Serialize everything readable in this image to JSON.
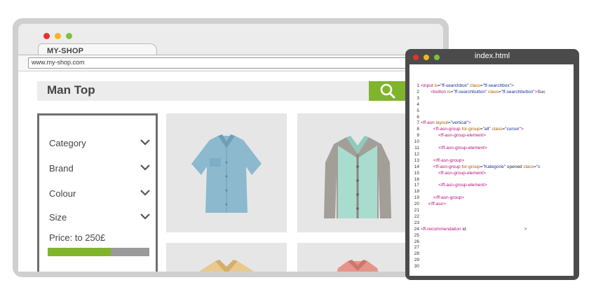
{
  "browser": {
    "tab_title": "MY-SHOP",
    "address": "www.my-shop.com"
  },
  "shop": {
    "search_title": "Man Top",
    "search_icon": "magnifier-icon",
    "filters": [
      {
        "label": "Category",
        "icon": "chevron-down-icon"
      },
      {
        "label": "Brand",
        "icon": "chevron-down-icon"
      },
      {
        "label": "Colour",
        "icon": "chevron-down-icon"
      },
      {
        "label": "Size",
        "icon": "chevron-down-icon"
      }
    ],
    "price_label": "Price:  to 250£",
    "price_fill_fraction": 0.62,
    "products": [
      {
        "name": "blue-short-sleeve-shirt"
      },
      {
        "name": "cardigan"
      },
      {
        "name": "yellow-shirt"
      },
      {
        "name": "red-shirt"
      }
    ]
  },
  "editor": {
    "title": "index.html",
    "lines": [
      {
        "n": "1",
        "code": "<input is=\"ff-searchbox\" class=\"ff-searchbox\">"
      },
      {
        "n": "2",
        "code": "        <button is=\"ff-searchbutton\" class=\"ff-searchbutton\">Suc"
      },
      {
        "n": "3",
        "code": ""
      },
      {
        "n": "4",
        "code": ""
      },
      {
        "n": "5",
        "code": ""
      },
      {
        "n": "6",
        "code": ""
      },
      {
        "n": "7",
        "code": "<ff-asn layout=\"vertical\">"
      },
      {
        "n": "8",
        "code": "          <ff-asn-group for-group=\"all\" class=\"cursor\">"
      },
      {
        "n": "9",
        "code": "              <ff-asn-group-element>"
      },
      {
        "n": "10",
        "code": ""
      },
      {
        "n": "11",
        "code": "              </ff-asn-group-element>"
      },
      {
        "n": "12",
        "code": ""
      },
      {
        "n": "13",
        "code": "          </ff-asn-group>"
      },
      {
        "n": "14",
        "code": "          <ff-asn-group for-group=\"Kategorie\" opened class=\"c"
      },
      {
        "n": "15",
        "code": "              <ff-asn-group-element>"
      },
      {
        "n": "16",
        "code": ""
      },
      {
        "n": "17",
        "code": "              </ff-asn-group-element>"
      },
      {
        "n": "18",
        "code": ""
      },
      {
        "n": "19",
        "code": "          </ff-asn-group>"
      },
      {
        "n": "20",
        "code": "      </ff-asn>"
      },
      {
        "n": "21",
        "code": ""
      },
      {
        "n": "22",
        "code": ""
      },
      {
        "n": "23",
        "code": ""
      },
      {
        "n": "24",
        "code": "<ff-recommendation id                                              >"
      },
      {
        "n": "25",
        "code": ""
      },
      {
        "n": "26",
        "code": ""
      },
      {
        "n": "27",
        "code": ""
      },
      {
        "n": "28",
        "code": ""
      },
      {
        "n": "29",
        "code": ""
      },
      {
        "n": "30",
        "code": ""
      }
    ]
  },
  "colors": {
    "accent_green": "#80b52b",
    "tag_magenta": "#b5127a",
    "value_blue": "#1a2f9c"
  }
}
